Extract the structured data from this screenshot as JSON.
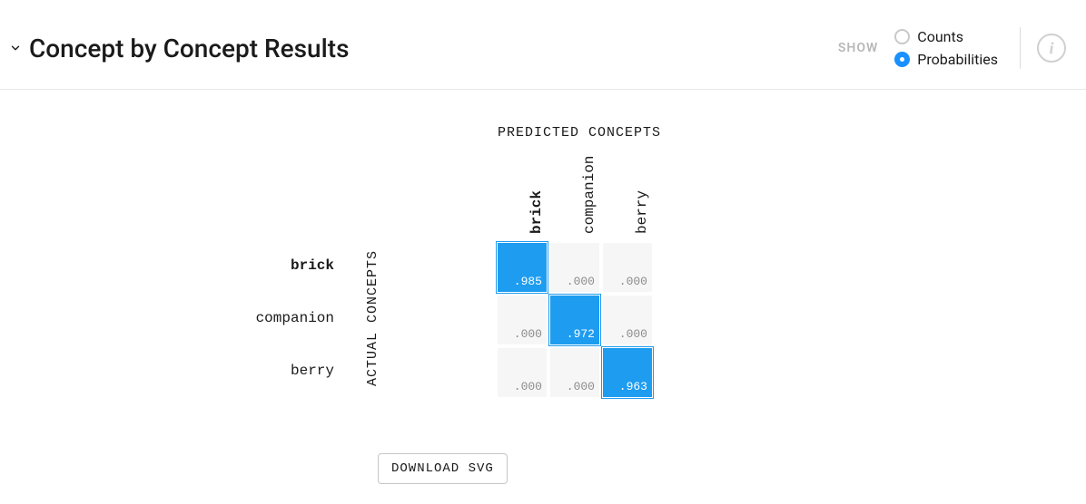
{
  "header": {
    "title": "Concept by Concept Results",
    "show_label": "SHOW",
    "options": {
      "counts": {
        "label": "Counts",
        "selected": false
      },
      "probabilities": {
        "label": "Probabilities",
        "selected": true
      }
    },
    "info_glyph": "i"
  },
  "axes": {
    "predicted": "PREDICTED CONCEPTS",
    "actual": "ACTUAL CONCEPTS"
  },
  "labels": {
    "rows": [
      "brick",
      "companion",
      "berry"
    ],
    "cols": [
      "brick",
      "companion",
      "berry"
    ]
  },
  "cells": {
    "r0c0": ".985",
    "r0c1": ".000",
    "r0c2": ".000",
    "r1c0": ".000",
    "r1c1": ".972",
    "r1c2": ".000",
    "r2c0": ".000",
    "r2c1": ".000",
    "r2c2": ".963"
  },
  "download_label": "DOWNLOAD SVG",
  "selected_index": 0,
  "chart_data": {
    "type": "heatmap",
    "title": "Concept by Concept Results",
    "xlabel": "PREDICTED CONCEPTS",
    "ylabel": "ACTUAL CONCEPTS",
    "categories_x": [
      "brick",
      "companion",
      "berry"
    ],
    "categories_y": [
      "brick",
      "companion",
      "berry"
    ],
    "values": [
      [
        0.985,
        0.0,
        0.0
      ],
      [
        0.0,
        0.972,
        0.0
      ],
      [
        0.0,
        0.0,
        0.963
      ]
    ],
    "value_range": [
      0,
      1
    ],
    "mode": "Probabilities",
    "selected_cell": {
      "row": 0,
      "col": 0,
      "label": "brick"
    }
  }
}
